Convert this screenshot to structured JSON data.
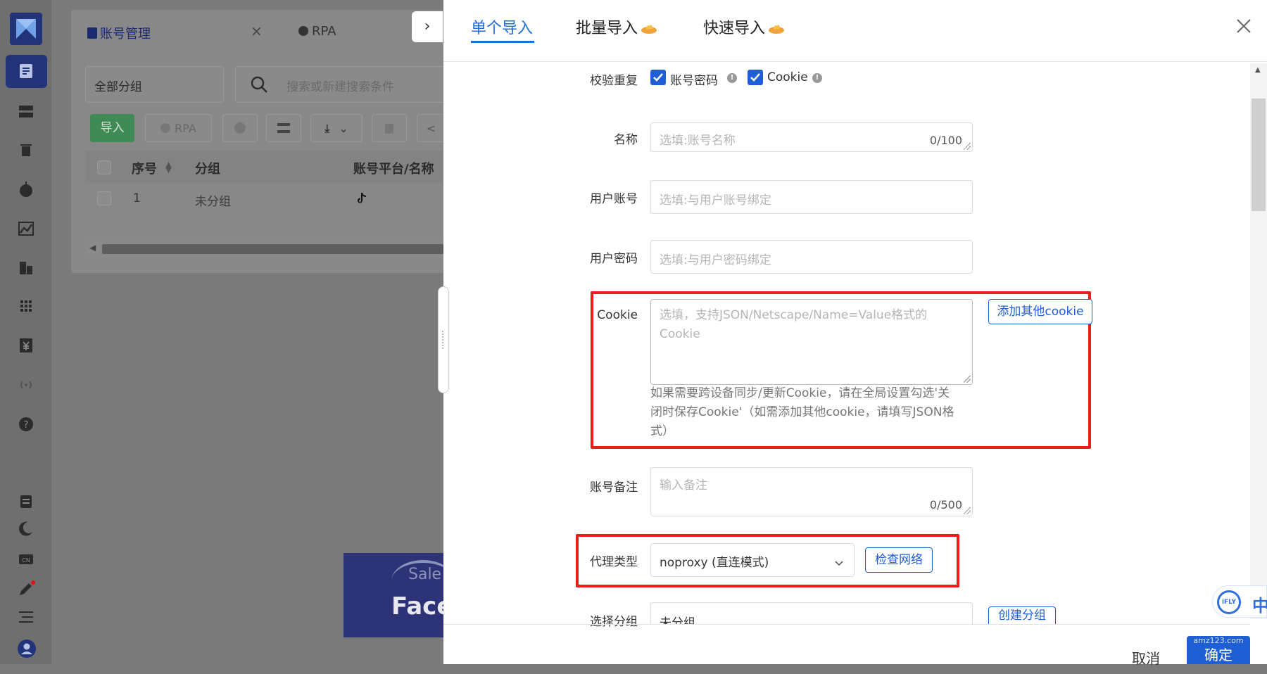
{
  "rail": {
    "icons": [
      "logo-icon",
      "account-list-icon",
      "server-icon",
      "trash-icon",
      "rpa-icon",
      "chart-icon",
      "building-icon",
      "grid-icon",
      "yen-icon",
      "signal-icon",
      "help-icon",
      "document-icon",
      "moon-icon",
      "cn-icon",
      "pen-icon",
      "menu-icon",
      "user-avatar-icon"
    ]
  },
  "background": {
    "tabs": [
      {
        "label": "账号管理",
        "icon": "account-list-icon"
      },
      {
        "label": "RPA",
        "icon": "rpa-icon"
      }
    ],
    "group_select": "全部分组",
    "search_placeholder": "搜索或新建搜索条件",
    "toolbar": {
      "import_label": "导入",
      "rpa_label": "RPA"
    },
    "table": {
      "columns": [
        "序号",
        "分组",
        "账号平台/名称"
      ],
      "rows": [
        {
          "index": "1",
          "group": "未分组",
          "platform_icon": "tiktok-icon"
        }
      ]
    },
    "ad": {
      "text1": "Sale",
      "text2": "Face"
    }
  },
  "drawer": {
    "tabs": [
      {
        "label": "单个导入",
        "active": true
      },
      {
        "label": "批量导入",
        "badge_icon": "fire-icon"
      },
      {
        "label": "快速导入",
        "badge_icon": "fire-icon"
      }
    ],
    "form": {
      "verify_dup": {
        "label": "校验重复",
        "options": [
          {
            "label": "账号密码",
            "checked": true
          },
          {
            "label": "Cookie",
            "checked": true
          }
        ]
      },
      "name": {
        "label": "名称",
        "placeholder": "选填:账号名称",
        "counter": "0/100"
      },
      "user_account": {
        "label": "用户账号",
        "placeholder": "选填:与用户账号绑定"
      },
      "user_password": {
        "label": "用户密码",
        "placeholder": "选填:与用户密码绑定"
      },
      "cookie": {
        "label": "Cookie",
        "placeholder_line1": "选填，支持JSON/Netscape/Name=Value格式的",
        "placeholder_line2": "Cookie",
        "add_button": "添加其他cookie",
        "hint_line1": "如果需要跨设备同步/更新Cookie，请在全局设置勾选'关",
        "hint_line2": "闭时保存Cookie'（如需添加其他cookie，请填写JSON格",
        "hint_line3": "式）"
      },
      "remark": {
        "label": "账号备注",
        "placeholder": "输入备注",
        "counter": "0/500"
      },
      "proxy": {
        "label": "代理类型",
        "value": "noproxy (直连模式)",
        "check_button": "检查网络"
      },
      "group": {
        "label": "选择分组",
        "value": "未分组",
        "create_button": "创建分组"
      }
    },
    "footer": {
      "cancel": "取消",
      "confirm": "确定",
      "watermark": "amz123.com"
    }
  },
  "ime": {
    "brand": "iFLY",
    "lang": "中"
  },
  "colors": {
    "primary": "#1f5fd6",
    "highlight_border": "#e4201c",
    "import_green": "#3f8a55",
    "rail_active": "#23337a"
  }
}
